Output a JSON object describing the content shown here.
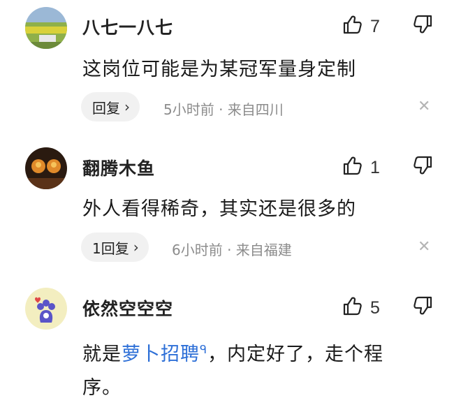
{
  "comments": [
    {
      "username": "八七一八七",
      "likes": "7",
      "text": "这岗位可能是为某冠军量身定制",
      "reply_label": "回复",
      "meta": "5小时前 · 来自四川"
    },
    {
      "username": "翻腾木鱼",
      "likes": "1",
      "text": "外人看得稀奇，其实还是很多的",
      "reply_label": "1回复",
      "meta": "6小时前 · 来自福建"
    },
    {
      "username": "依然空空空",
      "likes": "5",
      "text_before": "就是",
      "text_link": "萝卜招聘",
      "text_after": "，内定好了，走个程序。"
    }
  ],
  "icons": {
    "like": "thumbs-up-icon",
    "dislike": "thumbs-down-icon",
    "close": "close-icon",
    "reply_chevron": "chevron-right-icon",
    "search": "search-icon"
  },
  "colors": {
    "link": "#2d6fd7",
    "meta": "#8c8c8c",
    "reply_bg": "#f1f1f1"
  }
}
